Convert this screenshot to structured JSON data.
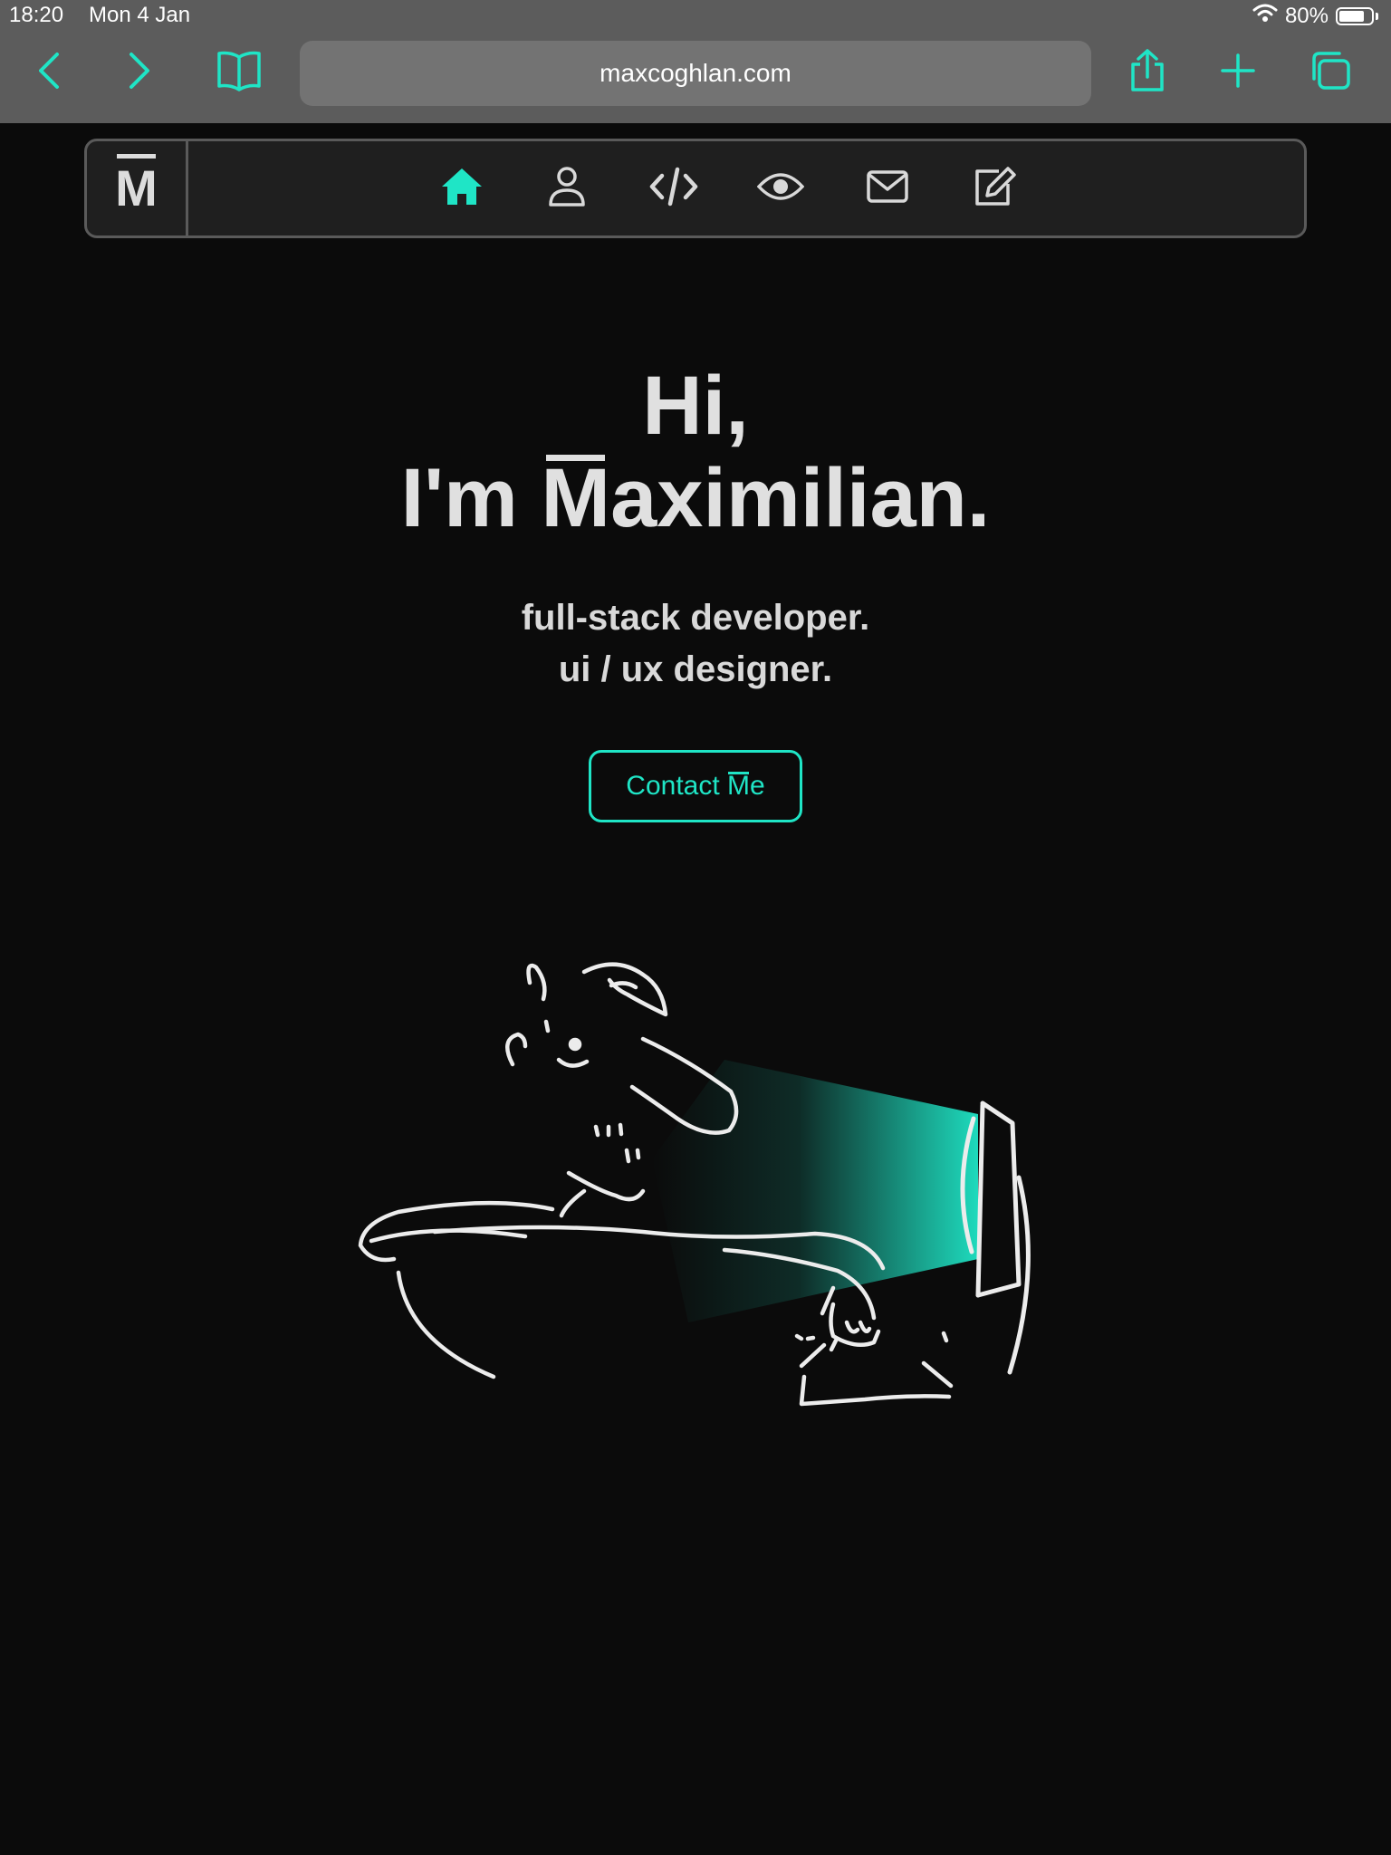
{
  "status_bar": {
    "time": "18:20",
    "date": "Mon 4 Jan",
    "battery": "80%",
    "battery_level": 0.8
  },
  "browser": {
    "url": "maxcoghlan.com",
    "icons": [
      "back-icon",
      "forward-icon",
      "bookmarks-icon",
      "share-icon",
      "new-tab-icon",
      "tabs-icon"
    ],
    "accent_color": "#1fe5c6"
  },
  "site_nav": {
    "logo": "M",
    "items": [
      {
        "icon": "home-icon",
        "active": true
      },
      {
        "icon": "person-icon",
        "active": false
      },
      {
        "icon": "code-icon",
        "active": false
      },
      {
        "icon": "eye-icon",
        "active": false
      },
      {
        "icon": "mail-icon",
        "active": false
      },
      {
        "icon": "edit-icon",
        "active": false
      }
    ],
    "active_color": "#1fe5c6",
    "icon_color": "#d9d9d9"
  },
  "hero": {
    "line1": "Hi,",
    "line2_prefix": "I'm ",
    "line2_initial": "M",
    "line2_rest": "aximilian.",
    "subtitle1": "full-stack developer.",
    "subtitle2": "ui / ux designer.",
    "contact_prefix": "Contact ",
    "contact_initial": "M",
    "contact_rest": "e"
  },
  "colors": {
    "background": "#0b0b0b",
    "accent": "#1fe5c6",
    "text": "#e0e0e0"
  }
}
